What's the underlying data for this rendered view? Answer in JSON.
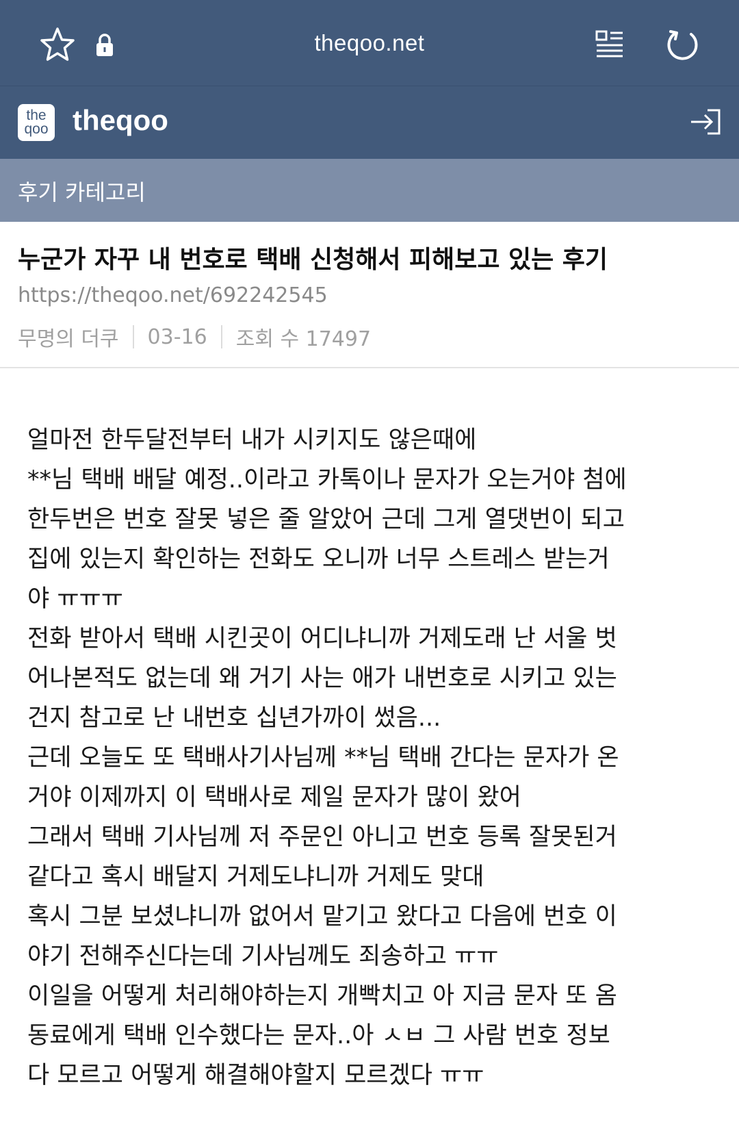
{
  "browser": {
    "url": "theqoo.net",
    "icons": [
      "star-icon",
      "lock-icon",
      "reader-mode-icon",
      "reload-icon"
    ]
  },
  "header": {
    "logo_text_top": "the",
    "logo_text_bottom": "qoo",
    "site_name": "theqoo",
    "login_icon": "login-icon"
  },
  "category": {
    "label": "후기 카테고리"
  },
  "post": {
    "title": "누군가 자꾸 내 번호로 택배 신청해서 피해보고 있는 후기",
    "link": "https://theqoo.net/692242545",
    "author": "무명의 더쿠",
    "date": "03-16",
    "views": "조회 수 17497",
    "body_lines": [
      "얼마전 한두달전부터 내가 시키지도 않은때에",
      "**님 택배 배달 예정..이라고 카톡이나 문자가 오는거야 첨에",
      "한두번은 번호 잘못 넣은 줄 알았어 근데 그게 열댓번이 되고",
      "집에 있는지 확인하는 전화도 오니까 너무 스트레스 받는거",
      "야 ㅠㅠㅠ",
      "전화 받아서 택배 시킨곳이 어디냐니까 거제도래 난 서울 벗",
      "어나본적도 없는데 왜 거기 사는 애가 내번호로 시키고 있는",
      "건지 참고로 난 내번호 십년가까이 썼음...",
      "근데 오늘도 또 택배사기사님께 **님 택배 간다는 문자가 온",
      "거야 이제까지 이 택배사로 제일 문자가 많이 왔어",
      "그래서 택배 기사님께 저 주문인 아니고 번호 등록 잘못된거",
      "같다고 혹시 배달지 거제도냐니까 거제도 맞대",
      "혹시 그분 보셨냐니까 없어서 맡기고 왔다고 다음에 번호 이",
      "야기 전해주신다는데 기사님께도 죄송하고 ㅠㅠ",
      "이일을 어떻게 처리해야하는지 개빡치고 아 지금 문자 또 옴",
      "동료에게 택배 인수했다는 문자..아 ㅅㅂ 그 사람 번호 정보",
      "다 모르고 어떻게 해결해야할지 모르겠다 ㅠㅠ"
    ]
  },
  "colors": {
    "header_bg": "#425a7b",
    "category_bg": "#7e8ea8",
    "meta_text": "#a0a0a0"
  }
}
